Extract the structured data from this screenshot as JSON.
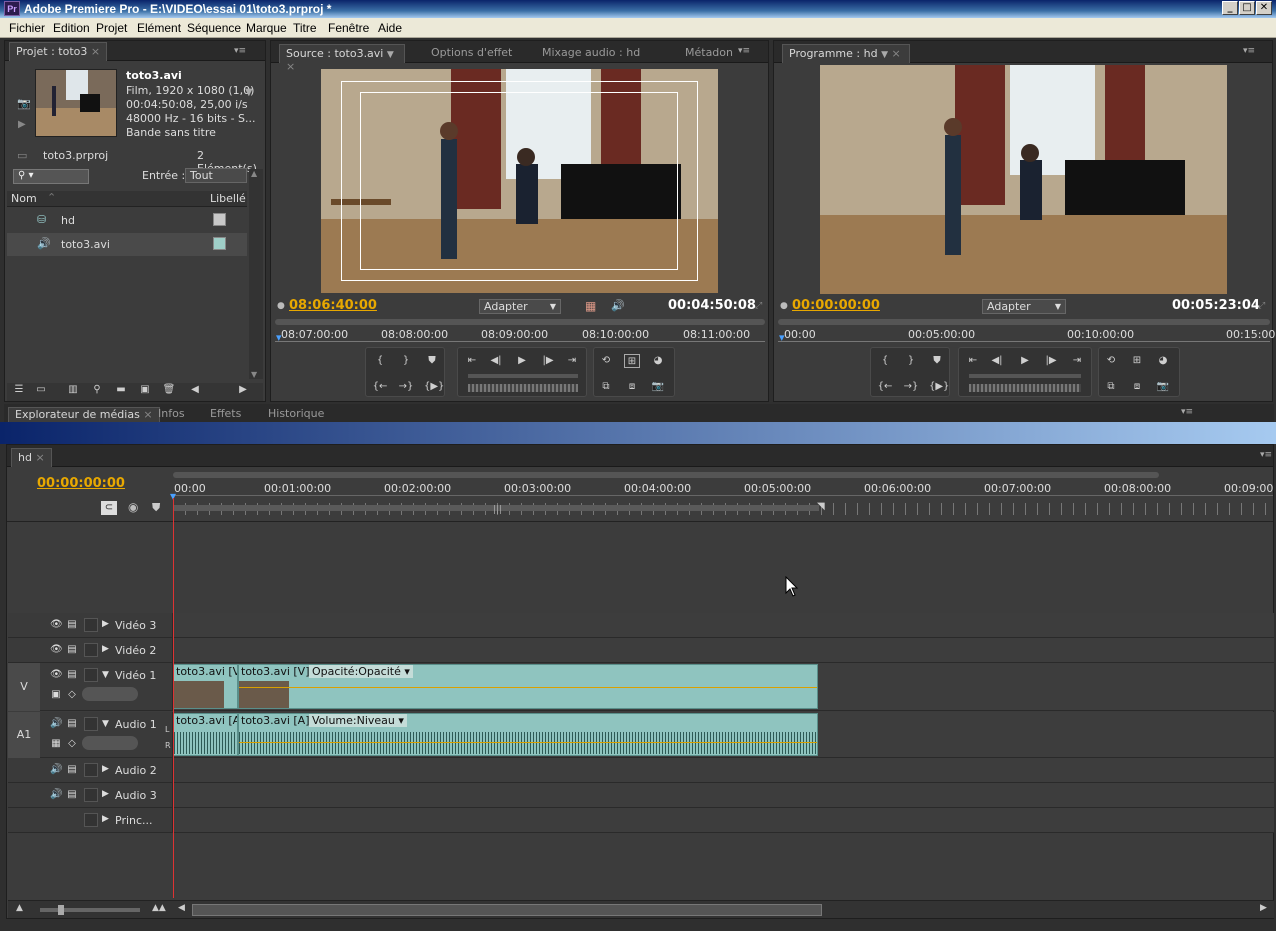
{
  "window": {
    "title": "Adobe Premiere Pro - E:\\VIDEO\\essai 01\\toto3.prproj *",
    "app_icon": "Pr",
    "controls": [
      "_",
      "□",
      "✕"
    ]
  },
  "menu": [
    "Fichier",
    "Edition",
    "Projet",
    "Elément",
    "Séquence",
    "Marque",
    "Titre",
    "Fenêtre",
    "Aide"
  ],
  "project": {
    "tab": "Projet : toto3",
    "clip_name": "toto3.avi",
    "info": [
      "Film, 1920 x 1080 (1,0)",
      "00:04:50:08, 25,00 i/s",
      "48000 Hz - 16  bits - S...",
      "Bande sans titre"
    ],
    "file": "toto3.prproj",
    "count": "2 Elément(s)",
    "entry_label": "Entrée :",
    "entry_value": "Tout",
    "col_name": "Nom",
    "col_label": "Libellé",
    "items": [
      {
        "name": "hd",
        "icon": "sequence-icon",
        "color": "#c8c8c8"
      },
      {
        "name": "toto3.avi",
        "icon": "audio-video-icon",
        "color": "#9fcfc8"
      }
    ]
  },
  "source": {
    "tabs": [
      "Source : toto3.avi",
      "Options d'effet",
      "Mixage audio : hd",
      "Métadon"
    ],
    "tc_current": "08:06:40:00",
    "fit": "Adapter",
    "tc_duration": "00:04:50:08",
    "ruler": [
      "08:07:00:00",
      "08:08:00:00",
      "08:09:00:00",
      "08:10:00:00",
      "08:11:00:00"
    ]
  },
  "program": {
    "tab": "Programme : hd",
    "tc_current": "00:00:00:00",
    "fit": "Adapter",
    "tc_duration": "00:05:23:04",
    "ruler": [
      "00:00",
      "00:05:00:00",
      "00:10:00:00",
      "00:15:00"
    ]
  },
  "bottom_tabs": [
    "Explorateur de médias",
    "Infos",
    "Effets",
    "Historique"
  ],
  "timeline": {
    "tab": "hd",
    "tc": "00:00:00:00",
    "ruler": [
      "00:00",
      "00:01:00:00",
      "00:02:00:00",
      "00:03:00:00",
      "00:04:00:00",
      "00:05:00:00",
      "00:06:00:00",
      "00:07:00:00",
      "00:08:00:00",
      "00:09:00"
    ],
    "tracks": {
      "v3": "Vidéo 3",
      "v2": "Vidéo 2",
      "v1": "Vidéo 1",
      "a1": "Audio 1",
      "a2": "Audio 2",
      "a3": "Audio 3",
      "master": "Princ..."
    },
    "target_v": "V",
    "target_a": "A1",
    "vclips": [
      "toto3.avi [V]",
      "toto3.avi [V]"
    ],
    "vfx": "Opacité:Opacité",
    "aclips": [
      "toto3.avi [A]",
      "toto3.avi [A]"
    ],
    "afx": "Volume:Niveau",
    "lr": [
      "L",
      "R"
    ]
  }
}
